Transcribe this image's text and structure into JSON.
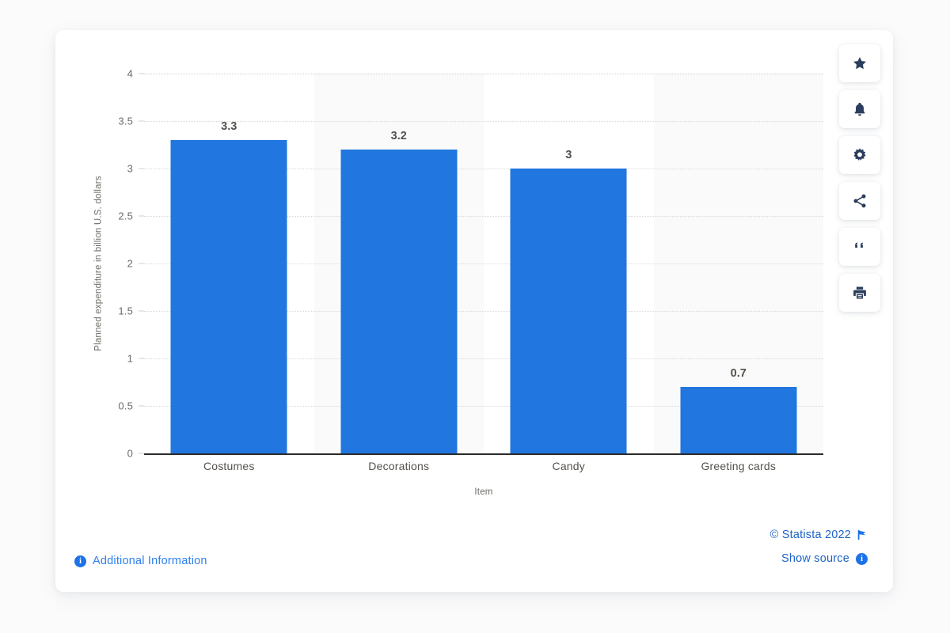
{
  "chart_data": {
    "type": "bar",
    "categories": [
      "Costumes",
      "Decorations",
      "Candy",
      "Greeting cards"
    ],
    "values": [
      3.3,
      3.2,
      3,
      0.7
    ],
    "value_labels": [
      "3.3",
      "3.2",
      "3",
      "0.7"
    ],
    "title": "",
    "xlabel": "Item",
    "ylabel": "Planned expenditure in billion U.S. dollars",
    "ylim": [
      0,
      4
    ],
    "yticks": [
      0,
      0.5,
      1,
      1.5,
      2,
      2.5,
      3,
      3.5,
      4
    ],
    "ytick_labels": [
      "0",
      "0.5",
      "1",
      "1.5",
      "2",
      "2.5",
      "3",
      "3.5",
      "4"
    ],
    "grid": true,
    "legend": "none",
    "bar_color": "#2176df",
    "band_color": "#fafafa"
  },
  "footer": {
    "additional_information": "Additional Information",
    "additional_information_icon": "info-circle-icon",
    "copyright": "© Statista 2022",
    "copyright_icon": "flag-icon",
    "show_source": "Show source",
    "show_source_icon": "info-circle-icon"
  },
  "toolbar": {
    "items": [
      {
        "name": "favorite",
        "icon": "star-icon"
      },
      {
        "name": "alert",
        "icon": "bell-icon"
      },
      {
        "name": "settings",
        "icon": "gear-icon"
      },
      {
        "name": "share",
        "icon": "share-icon"
      },
      {
        "name": "cite",
        "icon": "quote-icon"
      },
      {
        "name": "print",
        "icon": "print-icon"
      }
    ]
  },
  "colors": {
    "accent": "#2176df",
    "link": "#1e63c8",
    "icon": "#2c3e5d",
    "page_background": "#fbfbfc",
    "card_background": "#ffffff"
  }
}
